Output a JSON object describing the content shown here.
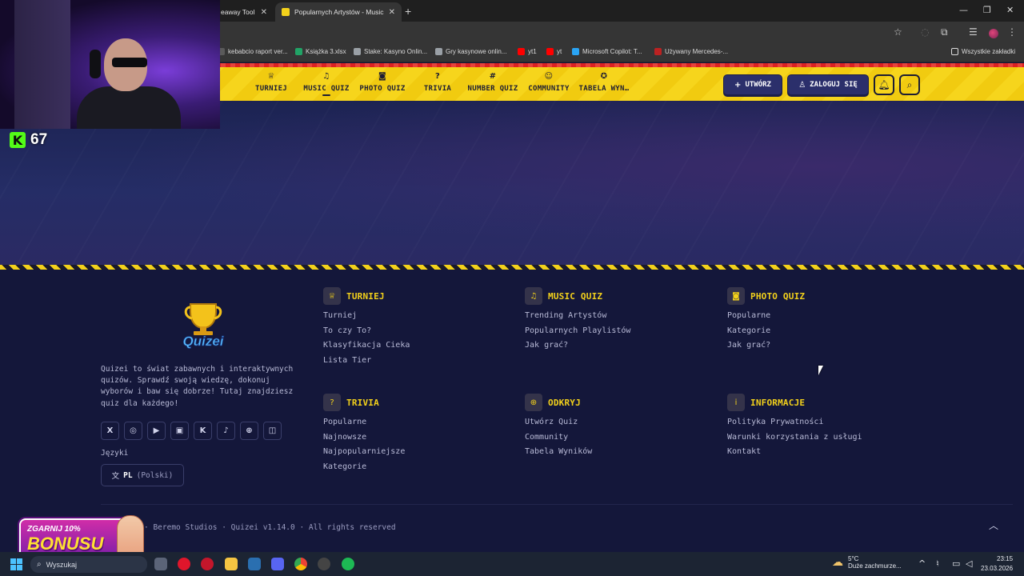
{
  "browser": {
    "tabs": [
      {
        "title": "eaway Tool",
        "active": false
      },
      {
        "title": "Popularnych Artystów - Music Q",
        "active": true
      }
    ],
    "bookmarks": [
      {
        "label": "kebabcio raport ver...",
        "color": "#5a5a5a"
      },
      {
        "label": "Książka 3.xlsx",
        "color": "#21a366"
      },
      {
        "label": "Stake: Kasyno Onlin...",
        "color": "#9aa0a6"
      },
      {
        "label": "Gry kasynowe onlin...",
        "color": "#9aa0a6"
      },
      {
        "label": "yt1",
        "color": "#ff0000"
      },
      {
        "label": "yt",
        "color": "#ff0000"
      },
      {
        "label": "Microsoft Copilot: T...",
        "color": "#2aa4f4"
      },
      {
        "label": "Używany Mercedes-...",
        "color": "#b22"
      },
      {
        "label": "Wszystkie zakładki",
        "color": "#dcdcdc"
      }
    ]
  },
  "stream": {
    "viewer_count": "67",
    "bonus_top": "ZGARNIJ 10%",
    "bonus_main": "BONUSU"
  },
  "nav": {
    "items": [
      {
        "label": "TURNIEJ",
        "icon": "trophy-icon",
        "glyph": "♕"
      },
      {
        "label": "MUSIC QUIZ",
        "icon": "music-icon",
        "glyph": "♫"
      },
      {
        "label": "PHOTO QUIZ",
        "icon": "camera-icon",
        "glyph": "◙"
      },
      {
        "label": "TRIVIA",
        "icon": "question-bubble-icon",
        "glyph": "?"
      },
      {
        "label": "NUMBER QUIZ",
        "icon": "hash-icon",
        "glyph": "#"
      },
      {
        "label": "COMMUNITY",
        "icon": "users-icon",
        "glyph": "☺"
      },
      {
        "label": "TABELA WYN…",
        "icon": "medal-icon",
        "glyph": "✪"
      }
    ],
    "create_label": "UTWÓRZ",
    "login_label": "ZALOGUJ SIĘ"
  },
  "footer": {
    "about": "Quizei to świat zabawnych i interaktywnych quizów. Sprawdź swoją wiedzę, dokonuj wyborów i baw się dobrze! Tutaj znajdziesz quiz dla każdego!",
    "languages_label": "Języki",
    "lang_code": "PL",
    "lang_name": "(Polski)",
    "socials": [
      {
        "icon": "x-icon",
        "glyph": "X"
      },
      {
        "icon": "instagram-icon",
        "glyph": "◎"
      },
      {
        "icon": "youtube-icon",
        "glyph": "▶"
      },
      {
        "icon": "twitch-icon",
        "glyph": "▣"
      },
      {
        "icon": "kick-icon",
        "glyph": "K"
      },
      {
        "icon": "tiktok-icon",
        "glyph": "♪"
      },
      {
        "icon": "globe-icon",
        "glyph": "⊕"
      },
      {
        "icon": "discord-icon",
        "glyph": "◫"
      }
    ],
    "columns": [
      {
        "title": "TURNIEJ",
        "icon": "trophy-icon",
        "glyph": "♕",
        "links": [
          "Turniej",
          "To czy To?",
          "Klasyfikacja Cieka",
          "Lista Tier"
        ]
      },
      {
        "title": "MUSIC QUIZ",
        "icon": "music-icon",
        "glyph": "♫",
        "links": [
          "Trending Artystów",
          "Popularnych Playlistów",
          "Jak grać?"
        ]
      },
      {
        "title": "PHOTO QUIZ",
        "icon": "camera-icon",
        "glyph": "◙",
        "links": [
          "Popularne",
          "Kategorie",
          "Jak grać?"
        ]
      },
      {
        "title": "TRIVIA",
        "icon": "question-bubble-icon",
        "glyph": "?",
        "links": [
          "Popularne",
          "Najnowsze",
          "Najpopularniejsze",
          "Kategorie"
        ]
      },
      {
        "title": "ODKRYJ",
        "icon": "globe-icon",
        "glyph": "⊕",
        "links": [
          "Utwórz Quiz",
          "Community",
          "Tabela Wyników"
        ]
      },
      {
        "title": "INFORMACJE",
        "icon": "info-icon",
        "glyph": "i",
        "links": [
          "Polityka Prywatności",
          "Warunki korzystania z usługi",
          "Kontakt"
        ]
      }
    ],
    "copyright": "· Beremo Studios · Quizei v1.14.0 · All rights reserved"
  },
  "taskbar": {
    "search_placeholder": "Wyszukaj",
    "weather_temp": "5°C",
    "weather_desc": "Duże zachmurze...",
    "time": "23:15",
    "date": "23.03.2026"
  },
  "colors": {
    "accent_yellow": "#f3d11b",
    "nav_button": "#2b2f6b",
    "footer_bg": "#14173a"
  }
}
